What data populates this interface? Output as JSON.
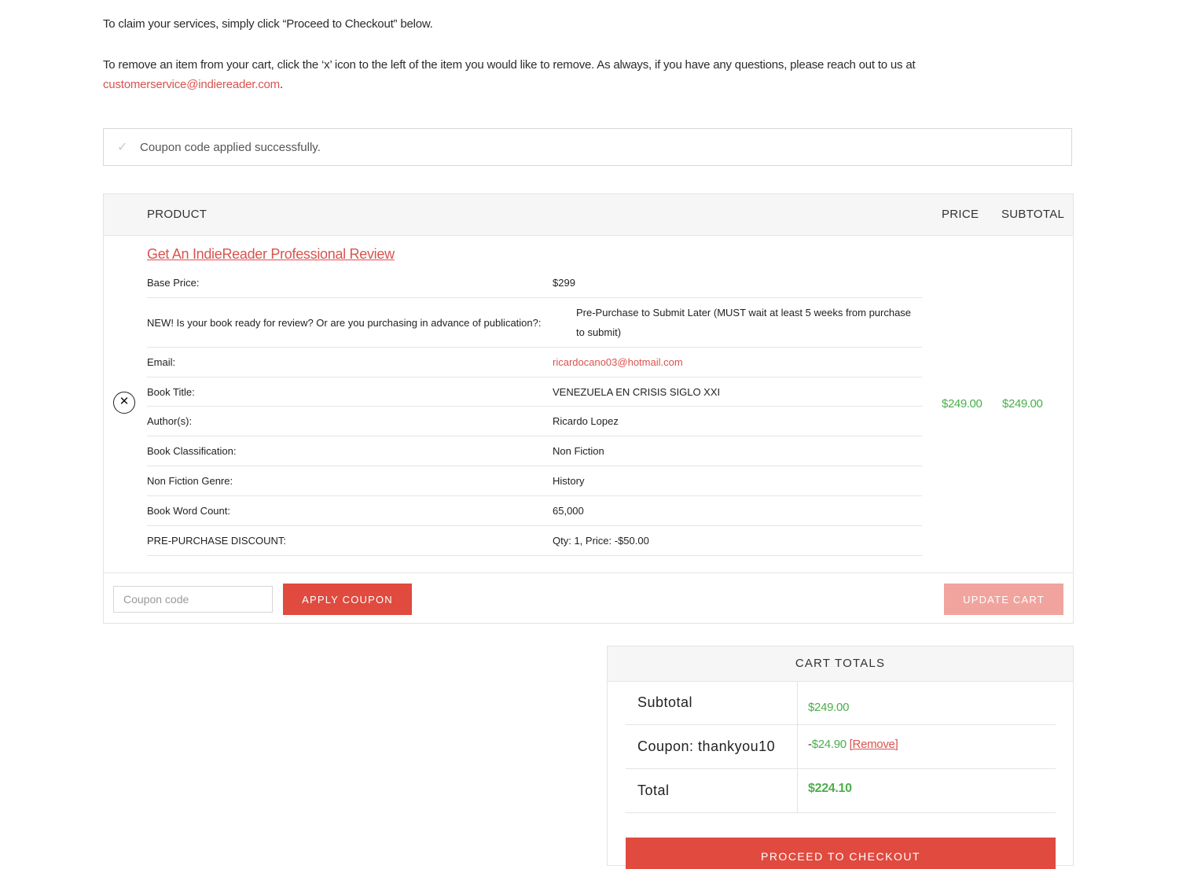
{
  "intro": {
    "line1": "To claim your services, simply click “Proceed to Checkout” below.",
    "line2_text": "To remove an item from your cart, click the ‘x’ icon to the left of the item you would like to remove. As always, if you have any questions, please reach out to us at ",
    "email": "customerservice@indiereader.com",
    "line2_end": "."
  },
  "notice": {
    "icon": "check-icon",
    "message": "Coupon code applied successfully."
  },
  "cart": {
    "headers": {
      "product": "PRODUCT",
      "price": "PRICE",
      "subtotal": "SUBTOTAL"
    },
    "item": {
      "remove_icon": "close-circle-icon",
      "remove_glyph": "✕",
      "title": "Get An IndieReader Professional Review",
      "meta": [
        {
          "key": "Base Price:",
          "value": "$299"
        },
        {
          "key": "NEW! Is your book ready for review? Or are you purchasing in advance of publication?:",
          "value": "Pre-Purchase to Submit Later (MUST wait at least 5 weeks from purchase to submit)"
        },
        {
          "key": "Email:",
          "value": "ricardocano03@hotmail.com"
        },
        {
          "key": "Book Title:",
          "value": "VENEZUELA EN CRISIS SIGLO XXI"
        },
        {
          "key": "Author(s):",
          "value": "Ricardo Lopez"
        },
        {
          "key": "Book Classification:",
          "value": "Non Fiction"
        },
        {
          "key": "Non Fiction Genre:",
          "value": "History"
        },
        {
          "key": "Book Word Count:",
          "value": "65,000"
        },
        {
          "key": "PRE-PURCHASE DISCOUNT:",
          "value": "Qty: 1, Price: -$50.00"
        }
      ],
      "price": "$249.00",
      "subtotal": "$249.00"
    },
    "actions": {
      "coupon_placeholder": "Coupon code",
      "apply_label": "APPLY COUPON",
      "update_label": "UPDATE CART"
    }
  },
  "totals": {
    "heading": "CART TOTALS",
    "subtotal_label": "Subtotal",
    "subtotal_value": "$249.00",
    "coupon_label": "Coupon: thankyou10",
    "coupon_dash": "-",
    "coupon_value": "$24.90",
    "coupon_remove": "[Remove]",
    "total_label": "Total",
    "total_value": "$224.10",
    "checkout_label": "PROCEED TO CHECKOUT"
  },
  "colors": {
    "accent": "#e04a3f",
    "accent_light": "#f0a49d",
    "link": "#d9534f",
    "money": "#4cae4c"
  }
}
